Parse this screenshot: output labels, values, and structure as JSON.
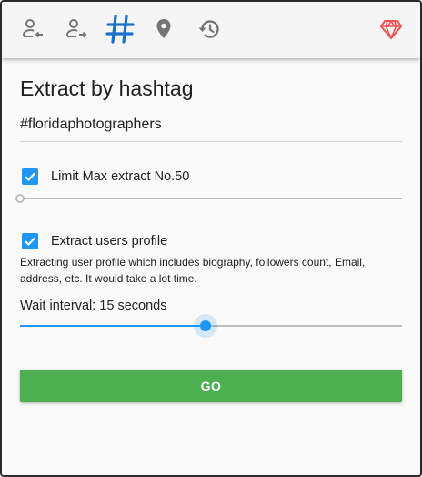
{
  "toolbar": {
    "icons": [
      "person-arrow-left-icon",
      "person-arrow-right-icon",
      "hashtag-icon",
      "location-pin-icon",
      "history-icon",
      "diamond-icon"
    ],
    "active": "hashtag-icon"
  },
  "colors": {
    "accent": "#2196f3",
    "active_tab": "#1e6fc9",
    "inactive_icon": "#757575",
    "premium": "#ef5350",
    "go_button": "#4caf50"
  },
  "main": {
    "title": "Extract by hashtag",
    "hashtag_value": "#floridaphotographers",
    "limit": {
      "checked": true,
      "label": "Limit Max extract No.50",
      "slider_fraction": 0.0
    },
    "profile": {
      "checked": true,
      "label": "Extract users profile",
      "description": "Extracting user profile which includes biography, followers count, Email, address, etc. It would take a lot time."
    },
    "wait": {
      "label": "Wait interval: 15 seconds",
      "slider_fraction": 0.485
    },
    "go_label": "GO"
  }
}
